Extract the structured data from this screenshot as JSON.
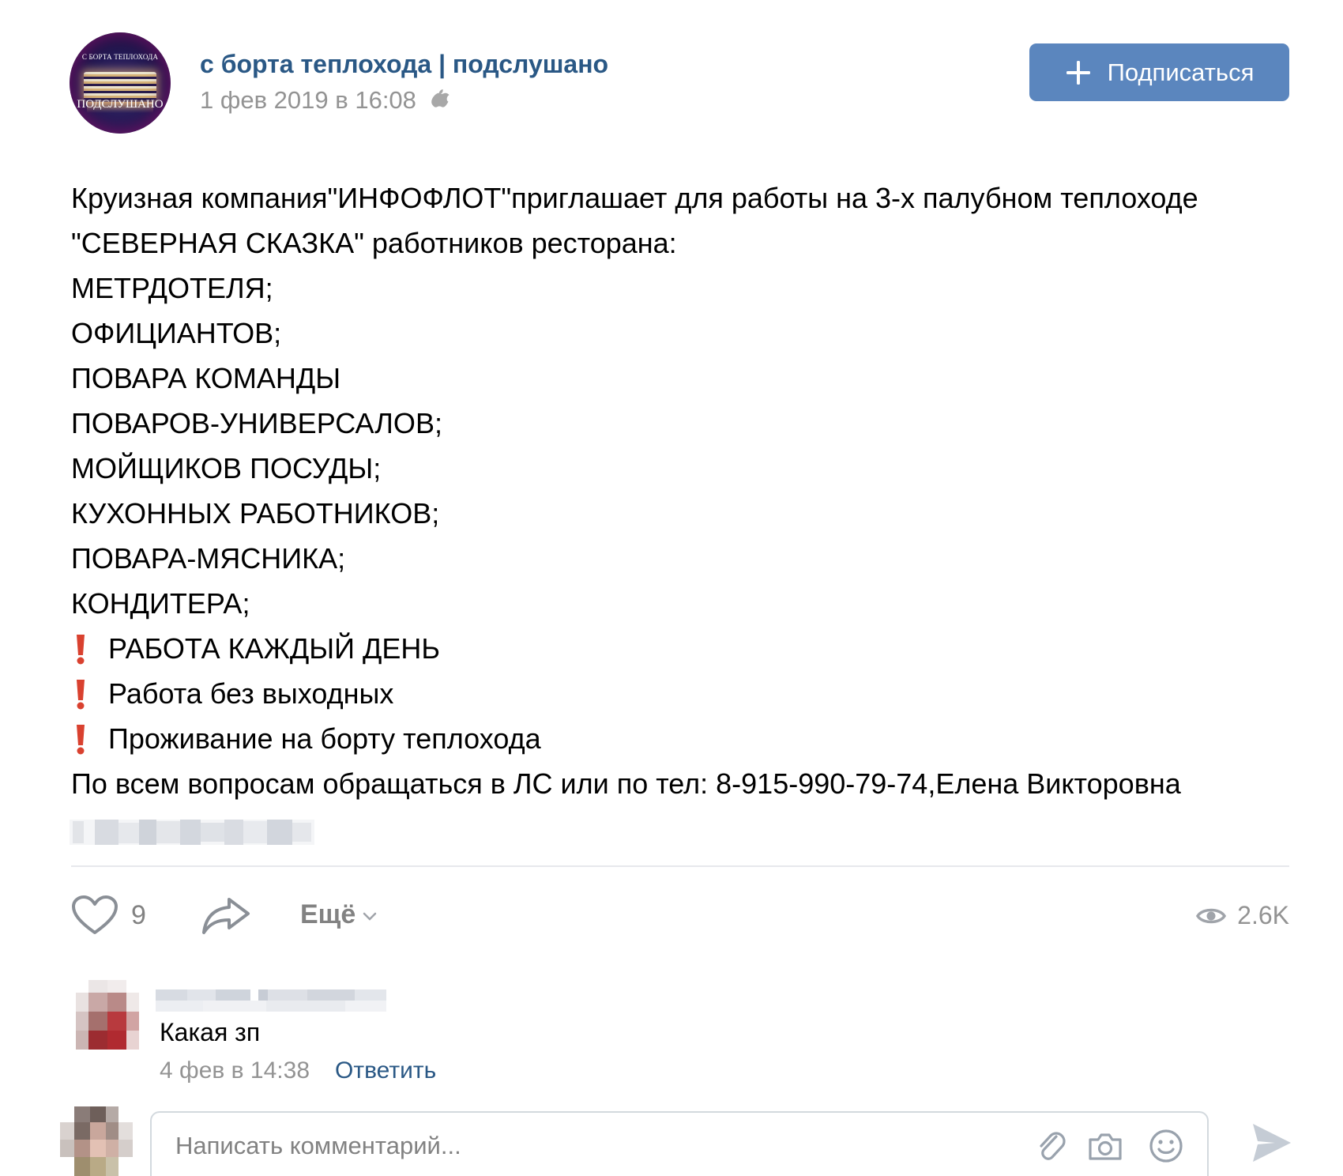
{
  "post": {
    "group_name": "с борта теплохода | подслушано",
    "date": "1 фев 2019 в 16:08",
    "avatar": {
      "top_text": "С БОРТА ТЕПЛОХОДА",
      "bottom_text": "ПОДСЛУШАНО"
    },
    "subscribe_label": "Подписаться",
    "text_lines": [
      "Круизная компания\"ИНФОФЛОТ\"приглашает для работы на 3-х палубном теплоходе",
      "\"СЕВЕРНАЯ СКАЗКА\" работников ресторана:",
      "МЕТРДОТЕЛЯ;",
      "ОФИЦИАНТОВ;",
      "ПОВАРА КОМАНДЫ",
      "ПОВАРОВ-УНИВЕРСАЛОВ;",
      "МОЙЩИКОВ ПОСУДЫ;",
      "КУХОННЫХ РАБОТНИКОВ;",
      "ПОВАРА-МЯСНИКА;",
      "КОНДИТЕРА;"
    ],
    "highlight_lines": [
      "РАБОТА КАЖДЫЙ ДЕНЬ",
      "Работа без выходных",
      "Проживание на борту теплохода"
    ],
    "contact_line": "По всем вопросам обращаться в ЛС или по тел: 8-915-990-79-74,Елена Викторовна",
    "likes": "9",
    "more_label": "Ещё",
    "views": "2.6K",
    "icons": [
      "apple-icon",
      "plus-icon",
      "exclamation-icon",
      "heart-icon",
      "share-icon",
      "chevron-down-icon",
      "eye-icon",
      "paperclip-icon",
      "camera-icon",
      "smile-icon",
      "send-icon"
    ],
    "colors": {
      "link": "#2a5885",
      "button": "#5b86be",
      "muted": "#939393",
      "exclamation": "#d9412f"
    }
  },
  "comment": {
    "text": "Какая зп",
    "date": "4 фев в 14:38",
    "reply_label": "Ответить"
  },
  "composer": {
    "placeholder": "Написать комментарий..."
  }
}
